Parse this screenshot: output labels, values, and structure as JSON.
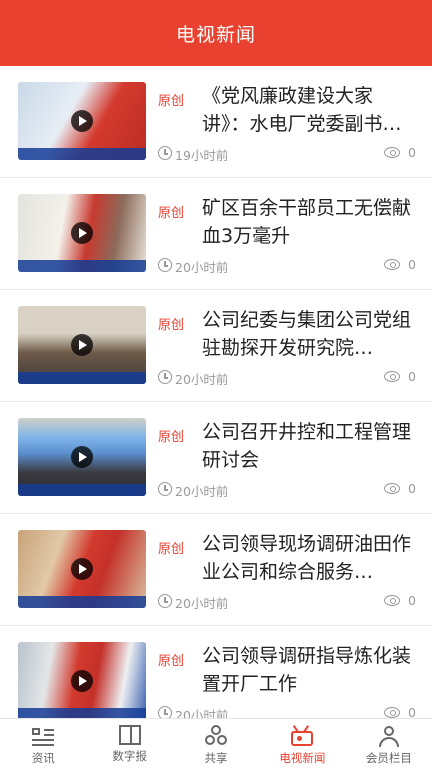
{
  "header": {
    "title": "电视新闻"
  },
  "articles": [
    {
      "tag": "原创",
      "title": "《党风廉政建设大家讲》：水电厂党委副书记…",
      "time": "19小时前",
      "views": "0"
    },
    {
      "tag": "原创",
      "title": "矿区百余干部员工无偿献血3万毫升",
      "time": "20小时前",
      "views": "0"
    },
    {
      "tag": "原创",
      "title": "公司纪委与集团公司党组驻勘探开发研究院…",
      "time": "20小时前",
      "views": "0"
    },
    {
      "tag": "原创",
      "title": "公司召开井控和工程管理研讨会",
      "time": "20小时前",
      "views": "0"
    },
    {
      "tag": "原创",
      "title": "公司领导现场调研油田作业公司和综合服务…",
      "time": "20小时前",
      "views": "0"
    },
    {
      "tag": "原创",
      "title": "公司领导调研指导炼化装置开厂工作",
      "time": "20小时前",
      "views": "0"
    }
  ],
  "tabbar": {
    "items": [
      {
        "label": "资讯",
        "icon": "news-icon",
        "active": false
      },
      {
        "label": "数字报",
        "icon": "newspaper-icon",
        "active": false
      },
      {
        "label": "共享",
        "icon": "share-icon",
        "active": false
      },
      {
        "label": "电视新闻",
        "icon": "tv-icon",
        "active": true
      },
      {
        "label": "会员栏目",
        "icon": "user-icon",
        "active": false
      }
    ]
  },
  "colors": {
    "accent": "#e8412f"
  }
}
